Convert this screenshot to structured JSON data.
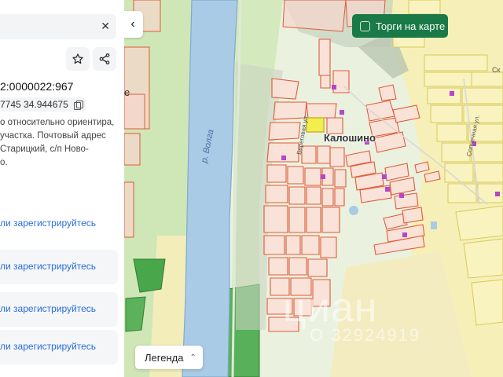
{
  "panel": {
    "cadastral_number": "2:0000022:967",
    "coordinates": "7745 34.944675",
    "address_lines": [
      "о относительно ориентира,",
      "участка. Почтовый адрес",
      " Старицкий, с/п Ново-",
      "о."
    ],
    "login_text": "ли зарегистрируйтесь",
    "login_blocks": [
      "ли зарегистрируйтесь",
      "ли зарегистрируйтесь",
      "ли зарегистрируйтесь"
    ],
    "icons": {
      "close": "close-icon",
      "favorite": "star-icon",
      "share": "share-icon",
      "copy": "copy-icon"
    }
  },
  "map": {
    "village_name": "Калошино",
    "river_name": "р. Волга",
    "street_left": "Береговая ул.",
    "street_right": "Солнечная ул.",
    "corner_text": "Ск",
    "side_text": "е",
    "watermark": "циан",
    "watermark_id": "О 32924919"
  },
  "controls": {
    "collapse_icon": "‹",
    "auction_label": "Торги на карте",
    "legend_label": "Легенда",
    "legend_chevron": "⌃"
  },
  "colors": {
    "auction_green": "#1a7a47",
    "link_blue": "#2b6cd9",
    "parcel_red": "#e05a3a",
    "river_blue": "#a9cbe6",
    "selected_parcel": "#f2ee4f"
  }
}
